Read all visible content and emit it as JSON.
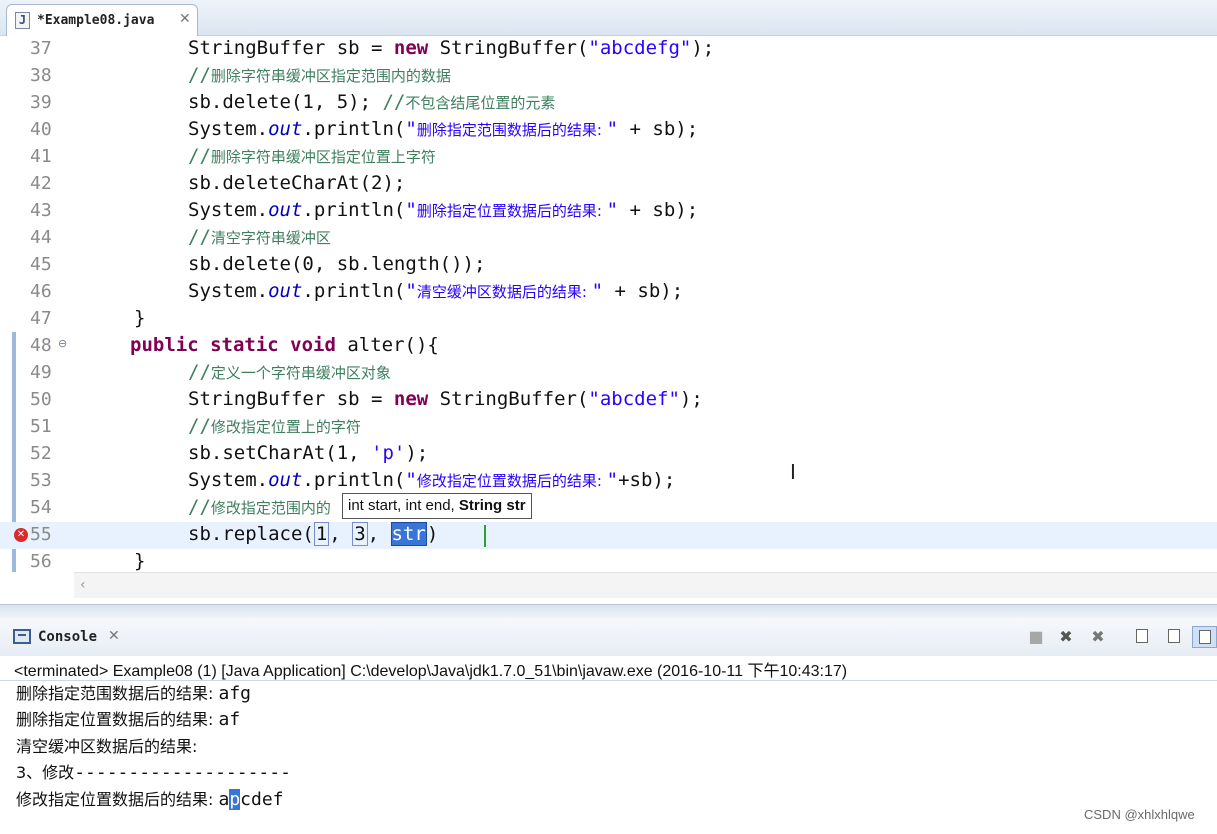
{
  "editor": {
    "tab_label": "*Example08.java",
    "tab_icon": "java-file-icon",
    "lines": [
      {
        "num": "37"
      },
      {
        "num": "38"
      },
      {
        "num": "39"
      },
      {
        "num": "40"
      },
      {
        "num": "41"
      },
      {
        "num": "42"
      },
      {
        "num": "43"
      },
      {
        "num": "44"
      },
      {
        "num": "45"
      },
      {
        "num": "46"
      },
      {
        "num": "47"
      },
      {
        "num": "48"
      },
      {
        "num": "49"
      },
      {
        "num": "50"
      },
      {
        "num": "51"
      },
      {
        "num": "52"
      },
      {
        "num": "53"
      },
      {
        "num": "54"
      },
      {
        "num": "55"
      },
      {
        "num": "56"
      }
    ],
    "tooltip": {
      "prefix": "int start, int end, ",
      "bold": "String str"
    }
  },
  "console": {
    "tab_label": "Console",
    "status": "<terminated> Example08 (1) [Java Application] C:\\develop\\Java\\jdk1.7.0_51\\bin\\javaw.exe (2016-10-11 下午10:43:17)",
    "output": {
      "line1_label": "删除指定范围数据后的结果: ",
      "line1_value": "afg",
      "line2_label": "删除指定位置数据后的结果: ",
      "line2_value": "af",
      "line3_label": "清空缓冲区数据后的结果:",
      "line4_label": "3、修改",
      "line4_dashes": "--------------------",
      "line5_label": "修改指定位置数据后的结果: ",
      "line5_value_a": "a",
      "line5_value_sel": "p",
      "line5_value_rest": "cdef"
    },
    "toolbar_icons": [
      "terminate-icon",
      "remove-launch-icon",
      "remove-all-icon",
      "scroll-lock-icon",
      "pin-console-icon",
      "display-console-icon"
    ]
  },
  "watermark": "CSDN @xhlxhlqwe",
  "colors": {
    "keyword": "#7f0055",
    "string": "#2a00ff",
    "field": "#0000c0",
    "comment": "#3f7f5f",
    "selection": "#3875d7"
  }
}
